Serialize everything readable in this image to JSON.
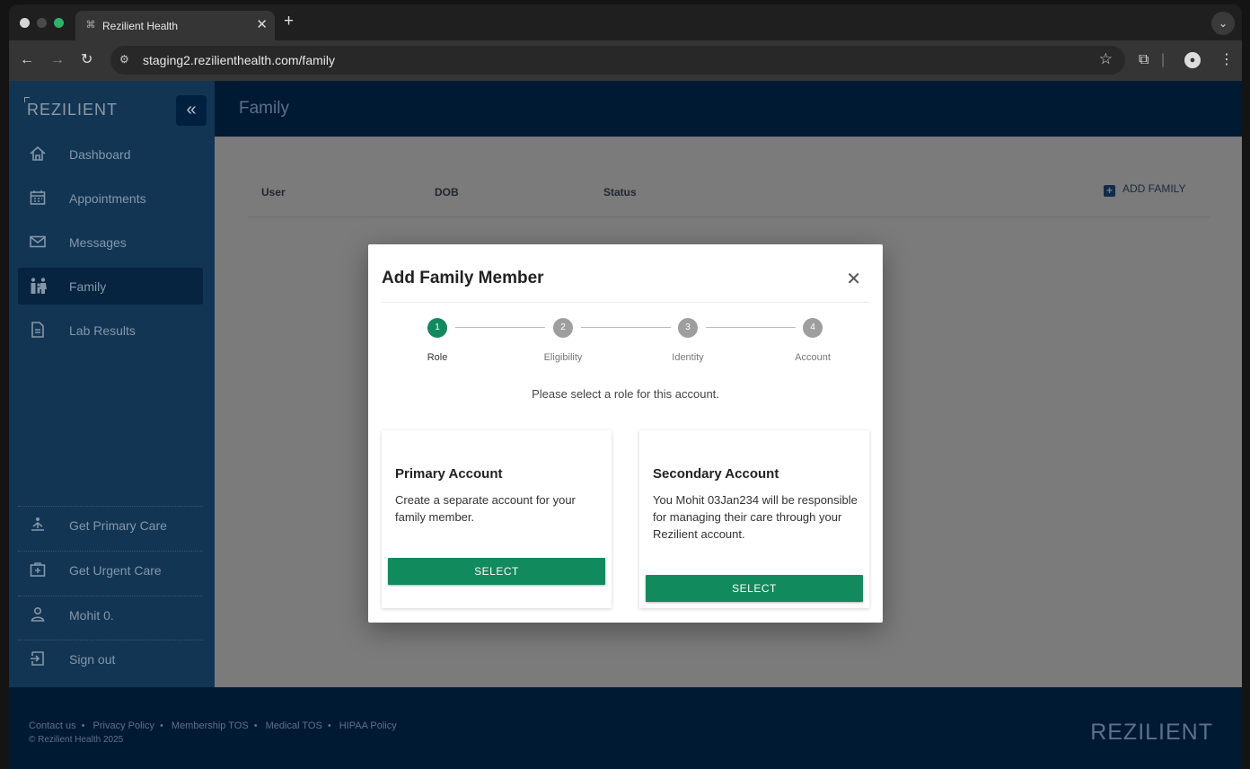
{
  "browser": {
    "tab_title": "Rezilient Health",
    "url": "staging2.rezilienthealth.com/family"
  },
  "sidebar": {
    "logo": "REZILIENT",
    "items": [
      {
        "label": "Dashboard",
        "icon": "home-icon"
      },
      {
        "label": "Appointments",
        "icon": "calendar-icon"
      },
      {
        "label": "Messages",
        "icon": "mail-icon"
      },
      {
        "label": "Family",
        "icon": "family-icon",
        "active": true
      },
      {
        "label": "Lab Results",
        "icon": "document-icon"
      }
    ],
    "bottom_items": [
      {
        "label": "Get Primary Care",
        "icon": "primary-care-icon"
      },
      {
        "label": "Get Urgent Care",
        "icon": "urgent-care-icon"
      },
      {
        "label": "Mohit 0.",
        "icon": "user-icon"
      },
      {
        "label": "Sign out",
        "icon": "sign-out-icon"
      }
    ]
  },
  "header": {
    "title": "Family"
  },
  "table": {
    "columns": [
      "User",
      "DOB",
      "Status"
    ],
    "add_label": "ADD FAMILY"
  },
  "modal": {
    "title": "Add Family Member",
    "steps": [
      {
        "num": "1",
        "label": "Role"
      },
      {
        "num": "2",
        "label": "Eligibility"
      },
      {
        "num": "3",
        "label": "Identity"
      },
      {
        "num": "4",
        "label": "Account"
      }
    ],
    "prompt": "Please select a role for this account.",
    "primary": {
      "title": "Primary Account",
      "description": "Create a separate account for your family member.",
      "button": "SELECT"
    },
    "secondary": {
      "title": "Secondary Account",
      "description": "You Mohit 03Jan234 will be responsible for managing their care through your Rezilient account.",
      "button": "SELECT"
    }
  },
  "footer": {
    "links": [
      "Contact us",
      "Privacy Policy",
      "Membership TOS",
      "Medical TOS",
      "HIPAA Policy"
    ],
    "copyright": "© Rezilient Health 2025",
    "logo": "REZILIENT"
  },
  "colors": {
    "sidebar": "#123554",
    "header": "#001a33",
    "accent": "#118a5e"
  }
}
